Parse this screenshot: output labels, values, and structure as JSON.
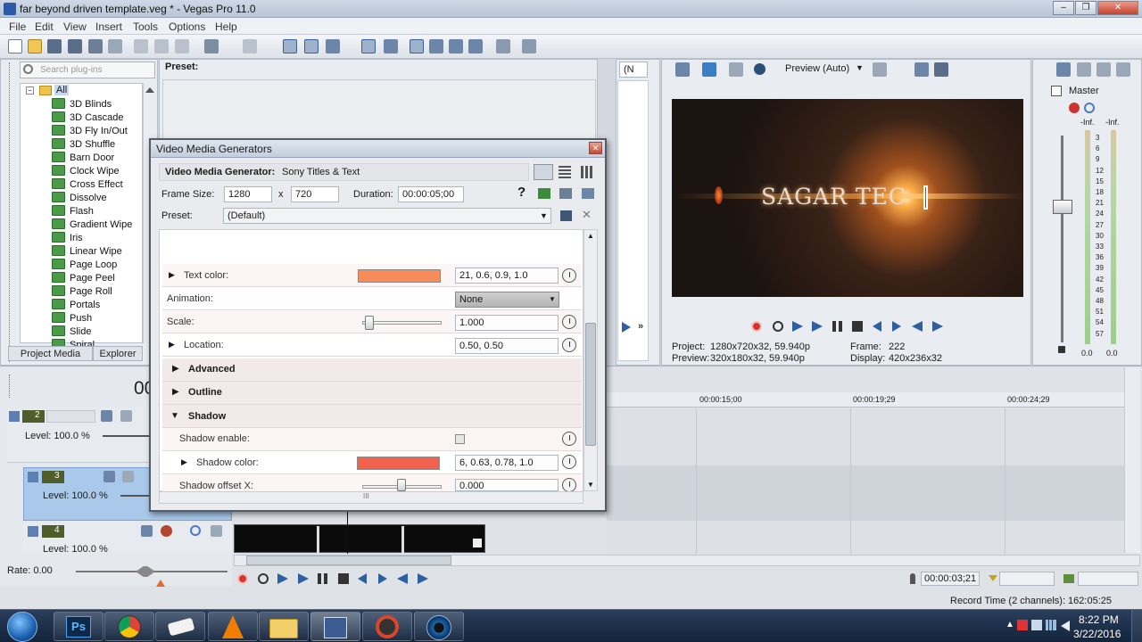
{
  "window": {
    "title": "far beyond driven template.veg * - Vegas Pro 11.0"
  },
  "menu": [
    "File",
    "Edit",
    "View",
    "Insert",
    "Tools",
    "Options",
    "Help"
  ],
  "plugins": {
    "search_placeholder": "Search plug-ins",
    "root": "All",
    "items": [
      "3D Blinds",
      "3D Cascade",
      "3D Fly In/Out",
      "3D Shuffle",
      "Barn Door",
      "Clock Wipe",
      "Cross Effect",
      "Dissolve",
      "Flash",
      "Gradient Wipe",
      "Iris",
      "Linear Wipe",
      "Page Loop",
      "Page Peel",
      "Page Roll",
      "Portals",
      "Push",
      "Slide",
      "Spiral"
    ],
    "tabs": [
      "Project Media",
      "Explorer"
    ]
  },
  "preset_panel": {
    "label": "Preset:"
  },
  "dialog": {
    "title": "Video Media Generators",
    "generator_label": "Video Media Generator:",
    "generator_name": "Sony Titles & Text",
    "frame_size_label": "Frame Size:",
    "frame_w": "1280",
    "x_sep": "x",
    "frame_h": "720",
    "duration_label": "Duration:",
    "duration": "00:00:05;00",
    "help": "?",
    "preset_label": "Preset:",
    "preset_value": "(Default)",
    "rows": {
      "text_color": {
        "label": "Text color:",
        "value": "21, 0.6, 0.9, 1.0",
        "color": "#f58c5a"
      },
      "animation": {
        "label": "Animation:",
        "value": "None"
      },
      "scale": {
        "label": "Scale:",
        "value": "1.000",
        "level": 0.07
      },
      "location": {
        "label": "Location:",
        "value": "0.50, 0.50"
      },
      "advanced": "Advanced",
      "outline": "Outline",
      "shadow": "Shadow",
      "shadow_enable": {
        "label": "Shadow enable:"
      },
      "shadow_color": {
        "label": "Shadow color:",
        "value": "6, 0.63, 0.78, 1.0",
        "color": "#f2604e"
      },
      "shadow_offset": {
        "label": "Shadow offset X:",
        "value": "0.000",
        "level": 0.5
      }
    },
    "scroll_marker": "III"
  },
  "preview": {
    "dropdown_short": "(N",
    "mode": "Preview (Auto)",
    "title_text": "SAGAR TEC",
    "project_label": "Project:",
    "project_value": "1280x720x32, 59.940p",
    "preview_label": "Preview:",
    "preview_value": "320x180x32, 59.940p",
    "frame_label": "Frame:",
    "frame_value": "222",
    "display_label": "Display:",
    "display_value": "420x236x32"
  },
  "master": {
    "label": "Master",
    "inf_left": "-Inf.",
    "inf_right": "-Inf.",
    "scale": [
      "3",
      "6",
      "9",
      "12",
      "15",
      "18",
      "21",
      "24",
      "27",
      "30",
      "33",
      "36",
      "39",
      "42",
      "45",
      "48",
      "51",
      "54",
      "57"
    ],
    "bottom_left": "0.0",
    "bottom_right": "0.0"
  },
  "timeline": {
    "timecode_partial": "00",
    "ruler": [
      "00:00:15;00",
      "00:00:19;29",
      "00:00:24;29"
    ],
    "tracks": [
      {
        "num": "2",
        "level": "Level: 100.0 %"
      },
      {
        "num": "3",
        "level": "Level: 100.0 %"
      },
      {
        "num": "4",
        "level": "Level: 100.0 %"
      }
    ],
    "rate": "Rate: 0.00",
    "current_time": "00:00:03;21",
    "record_time": "Record Time (2 channels): 162:05:25"
  },
  "taskbar": {
    "apps": [
      "windows-start",
      "photoshop",
      "chrome",
      "eraser",
      "vlc",
      "explorer",
      "vegas-floppy",
      "media-app",
      "camera-app"
    ],
    "ps_label": "Ps",
    "time": "8:22 PM",
    "date": "3/22/2016"
  }
}
